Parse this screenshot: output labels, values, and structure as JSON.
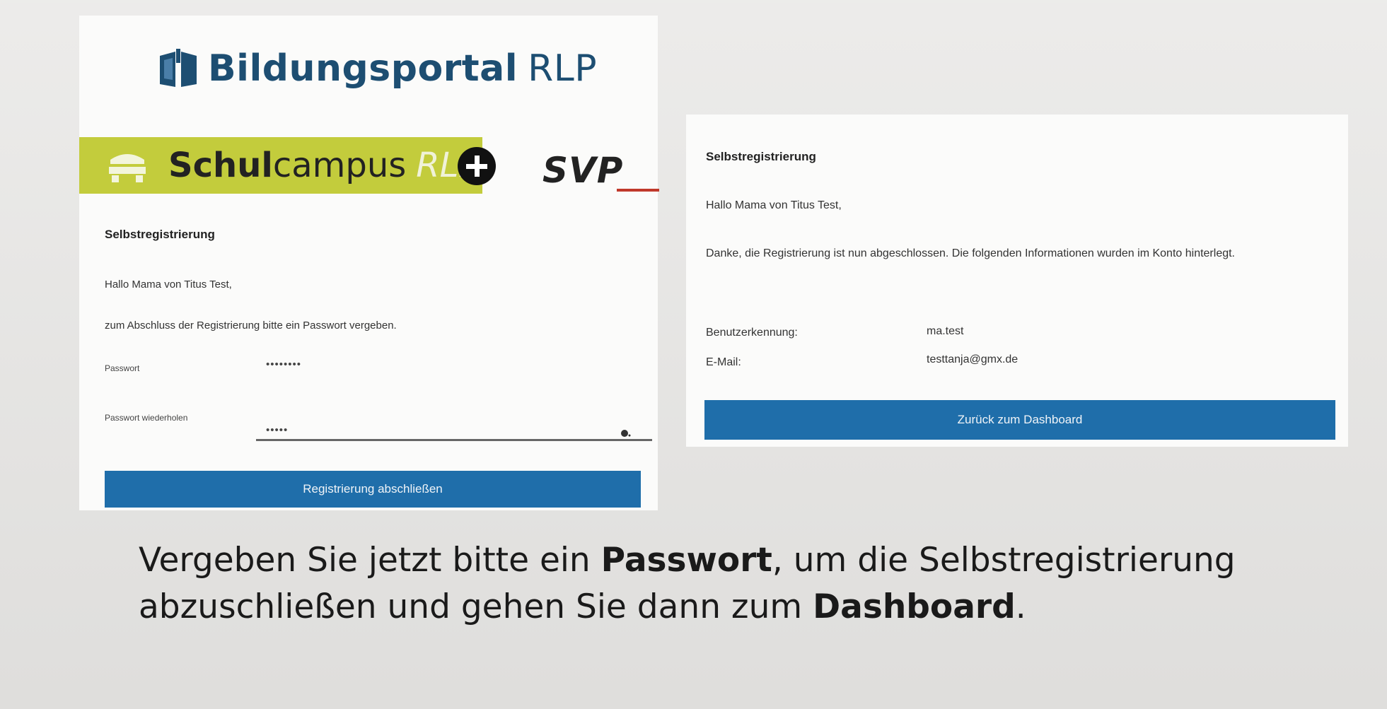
{
  "brand": {
    "name": "Bildungsportal",
    "suffix": "RLP",
    "color": "#1d4e72"
  },
  "campus_banner": {
    "bold": "Schul",
    "light": "campus",
    "italic": "RLP",
    "color": "#c3cc3c"
  },
  "svp_logo": {
    "text": "SVP"
  },
  "left_form": {
    "title": "Selbstregistrierung",
    "greeting": "Hallo Mama von Titus Test,",
    "instruction": "zum Abschluss der Registrierung bitte ein Passwort vergeben.",
    "password_label": "Passwort",
    "password_value": "••••••••",
    "password_repeat_label": "Passwort wiederholen",
    "password_repeat_value": "•••••",
    "submit_label": "Registrierung abschließen"
  },
  "right_form": {
    "title": "Selbstregistrierung",
    "greeting": "Hallo Mama von Titus Test,",
    "thanks": "Danke, die Registrierung ist nun abgeschlossen. Die folgenden Informationen wurden im Konto hinterlegt.",
    "username_label": "Benutzerkennung:",
    "username_value": "ma.test",
    "email_label": "E-Mail:",
    "email_value": "testtanja@gmx.de",
    "dashboard_label": "Zurück zum Dashboard"
  },
  "caption": {
    "part1": "Vergeben Sie jetzt bitte ein ",
    "bold1": "Passwort",
    "part2": ", um die Selbstregistrierung abzuschließen und gehen Sie dann zum ",
    "bold2": "Dashboard",
    "part3": "."
  },
  "colors": {
    "button": "#1f6eaa",
    "banner": "#c3cc3c",
    "brand": "#1d4e72"
  }
}
